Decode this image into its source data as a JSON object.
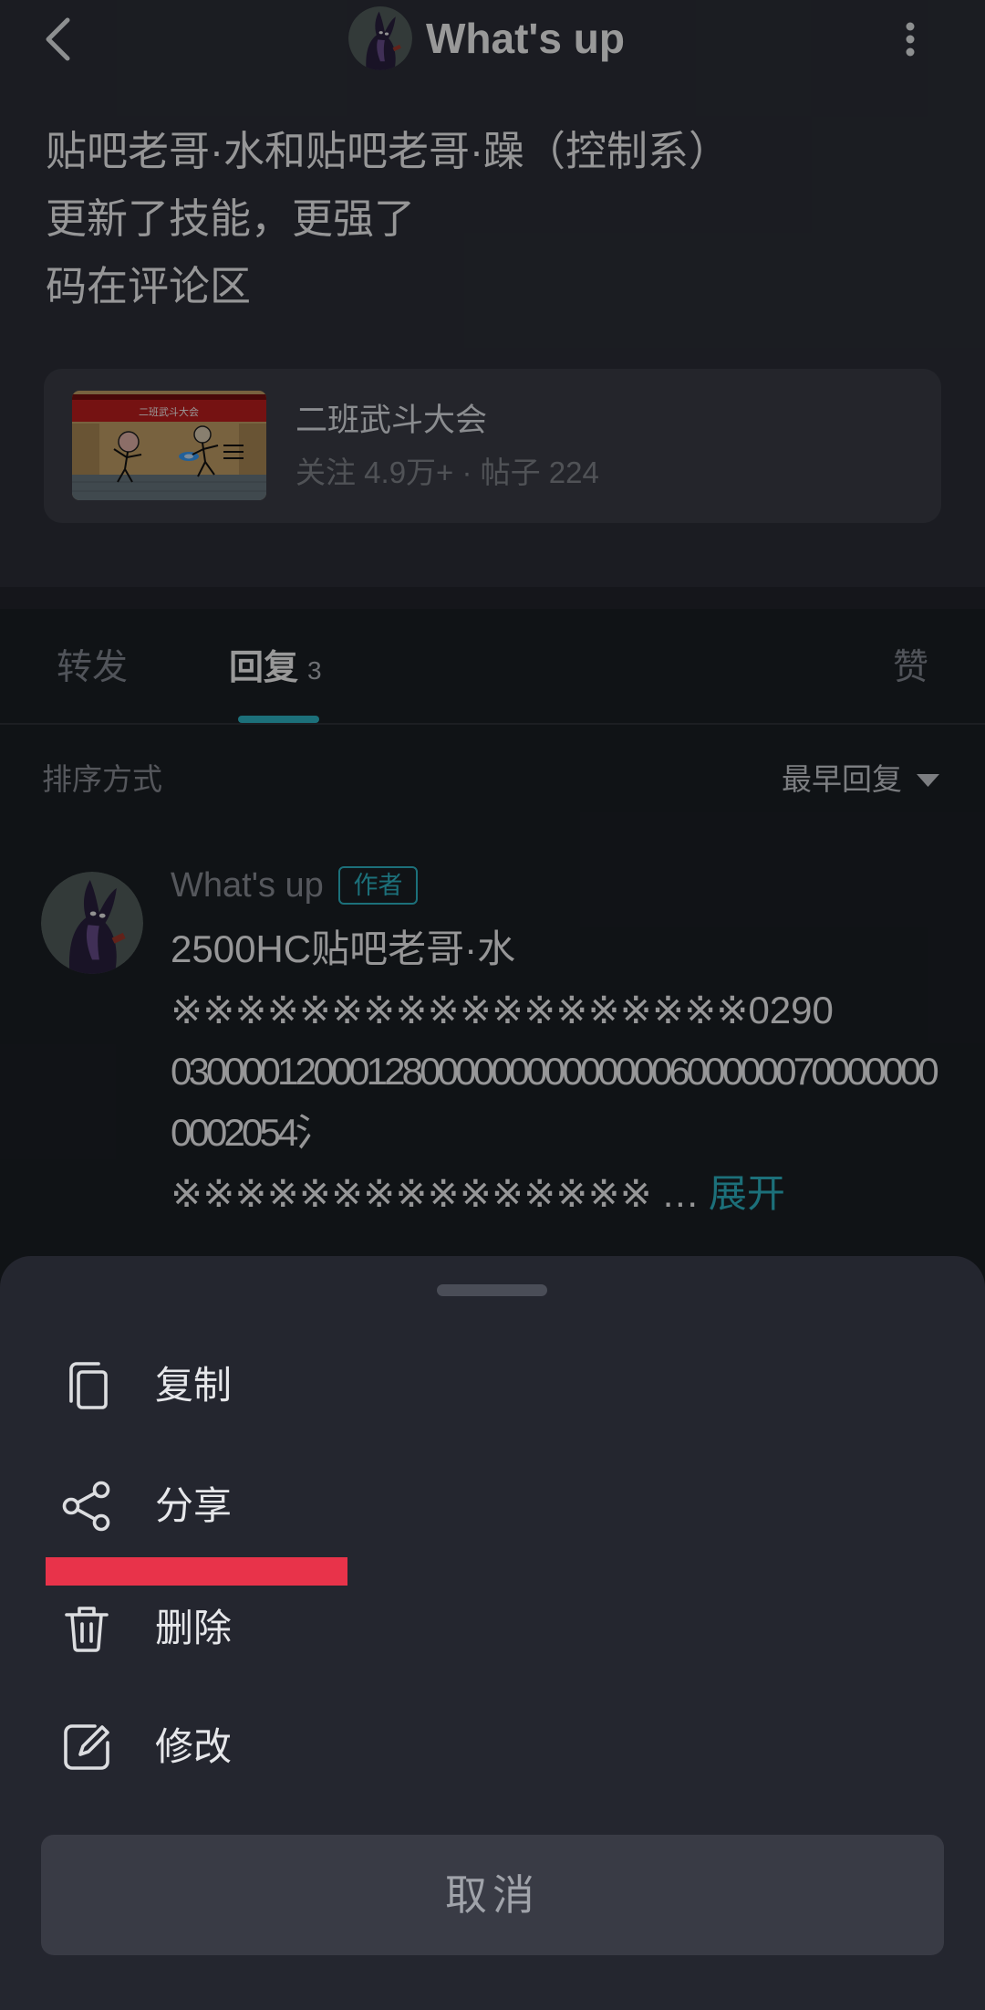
{
  "header": {
    "title": "What's up",
    "back_icon": "chevron-left-icon",
    "more_icon": "more-vertical-icon"
  },
  "post": {
    "lines": [
      "贴吧老哥·水和贴吧老哥·躁（控制系）",
      "更新了技能，更强了",
      "码在评论区"
    ]
  },
  "forum_card": {
    "name": "二班武斗大会",
    "thumbnail_banner": "二班武斗大会",
    "stats": "关注 4.9万+ · 帖子 224"
  },
  "tabs": [
    {
      "label": "转发"
    },
    {
      "label": "回复",
      "count": "3",
      "active": true
    },
    {
      "label": "赞"
    }
  ],
  "sort": {
    "label": "排序方式",
    "selected": "最早回复",
    "icon": "caret-down-icon"
  },
  "comment": {
    "author": "What's up",
    "badge": "作者",
    "lines": [
      "2500HC贴吧老哥·水",
      "※※※※※※※※※※※※※※※※※※0290",
      "0300001200012800000000000000600000070000000",
      "0002054氵",
      "※※※※※※※※※※※※※※※"
    ],
    "ellipsis": "…",
    "expand": "展开"
  },
  "action_sheet": {
    "items": [
      {
        "label": "复制",
        "icon": "copy-icon"
      },
      {
        "label": "分享",
        "icon": "share-icon"
      },
      {
        "label": "删除",
        "icon": "trash-icon"
      },
      {
        "label": "修改",
        "icon": "edit-icon"
      }
    ],
    "cancel": "取消"
  },
  "theme": {
    "accent": "#2fbbcb",
    "highlight": "#e8334a"
  }
}
